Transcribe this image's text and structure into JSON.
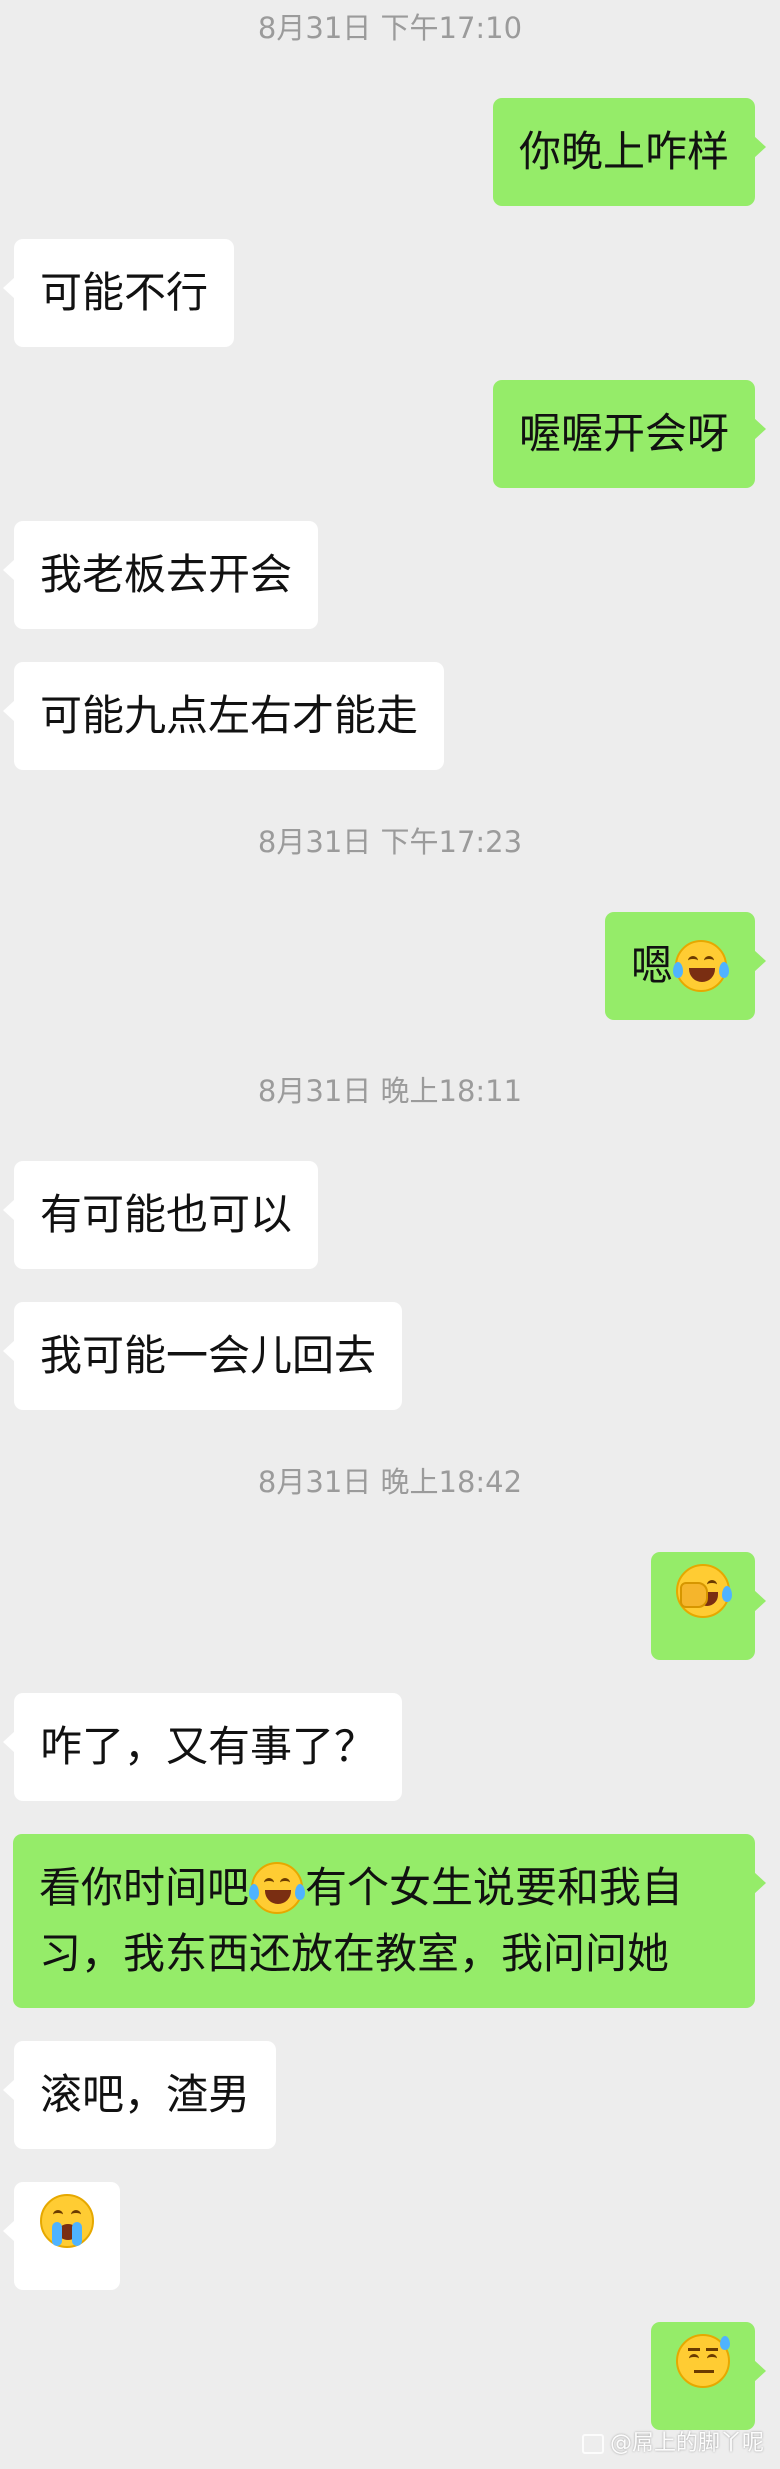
{
  "timestamps": {
    "t1": "8月31日 下午17:10",
    "t2": "8月31日 下午17:23",
    "t3": "8月31日 晚上18:11",
    "t4": "8月31日 晚上18:42"
  },
  "messages": {
    "m1": "你晚上咋样",
    "m2": "可能不行",
    "m3": "喔喔开会呀",
    "m4": "我老板去开会",
    "m5": "可能九点左右才能走",
    "m6": "嗯",
    "m7": "有可能也可以",
    "m8": "我可能一会儿回去",
    "m10": "咋了，又有事了？",
    "m11a": "看你时间吧",
    "m11b": "有个女生说要和我自习，我东西还放在教室，我问问她",
    "m12": "滚吧，渣男"
  },
  "emoji_names": {
    "m6": "joy-emoji",
    "m9": "facepalm-emoji",
    "m11": "joy-emoji",
    "m13": "crying-emoji",
    "m14": "sweat-emoji"
  },
  "watermark": "@屌上的脚丫呢",
  "colors": {
    "background": "#ededed",
    "sent_bubble": "#95ec69",
    "received_bubble": "#ffffff",
    "timestamp": "#9b9b9b"
  }
}
